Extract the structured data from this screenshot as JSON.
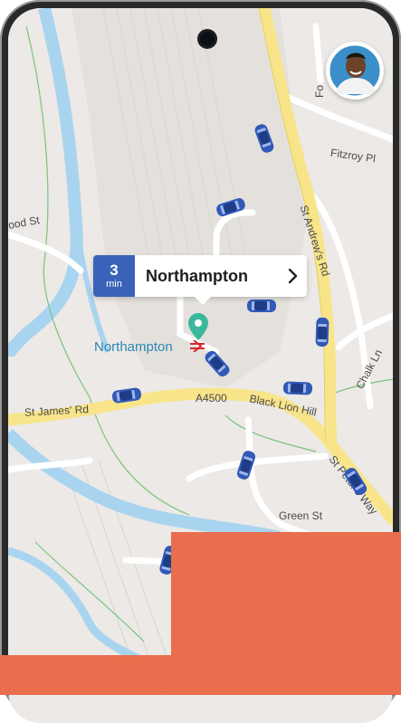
{
  "eta_card": {
    "minutes": "3",
    "unit": "min",
    "destination": "Northampton"
  },
  "station": {
    "label": "Northampton"
  },
  "streets": {
    "st_james_rd": "St James' Rd",
    "a4500": "A4500",
    "black_lion_hill": "Black Lion Hill",
    "st_peters_way": "St Peter's Way",
    "st_andrews_rd": "St Andrew's Rd",
    "green_st": "Green St",
    "fitzroy_pl": "Fitzroy Pl",
    "chalk_ln": "Chalk Ln",
    "wood_st": "ood St",
    "st_partial": "St",
    "fo_partial": "Fo"
  },
  "colors": {
    "eta_accent": "#3a62b8",
    "station_text": "#2a86b5",
    "pin": "#3ab89c",
    "overlay": "#e86e4d",
    "water": "#a9d4f0",
    "main_road": "#f8e58a",
    "car": "#3159b8"
  },
  "icons": [
    "camera-icon",
    "avatar",
    "chevron-right-icon",
    "location-pin-icon",
    "rail-icon",
    "car-icon"
  ]
}
